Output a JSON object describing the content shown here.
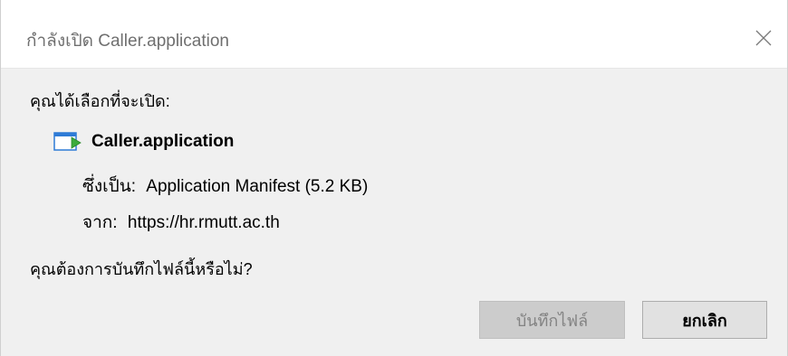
{
  "dialog": {
    "title": "กำลังเปิด Caller.application",
    "close_icon": "close-icon"
  },
  "prompt": "คุณได้เลือกที่จะเปิด:",
  "file": {
    "icon": "application-file-icon",
    "name": "Caller.application",
    "type_label": "ซึ่งเป็น:",
    "type_value": "Application Manifest (5.2 KB)",
    "from_label": "จาก:",
    "from_value": "https://hr.rmutt.ac.th"
  },
  "question": "คุณต้องการบันทึกไฟล์นี้หรือไม่?",
  "buttons": {
    "save": "บันทึกไฟล์",
    "cancel": "ยกเลิก"
  }
}
